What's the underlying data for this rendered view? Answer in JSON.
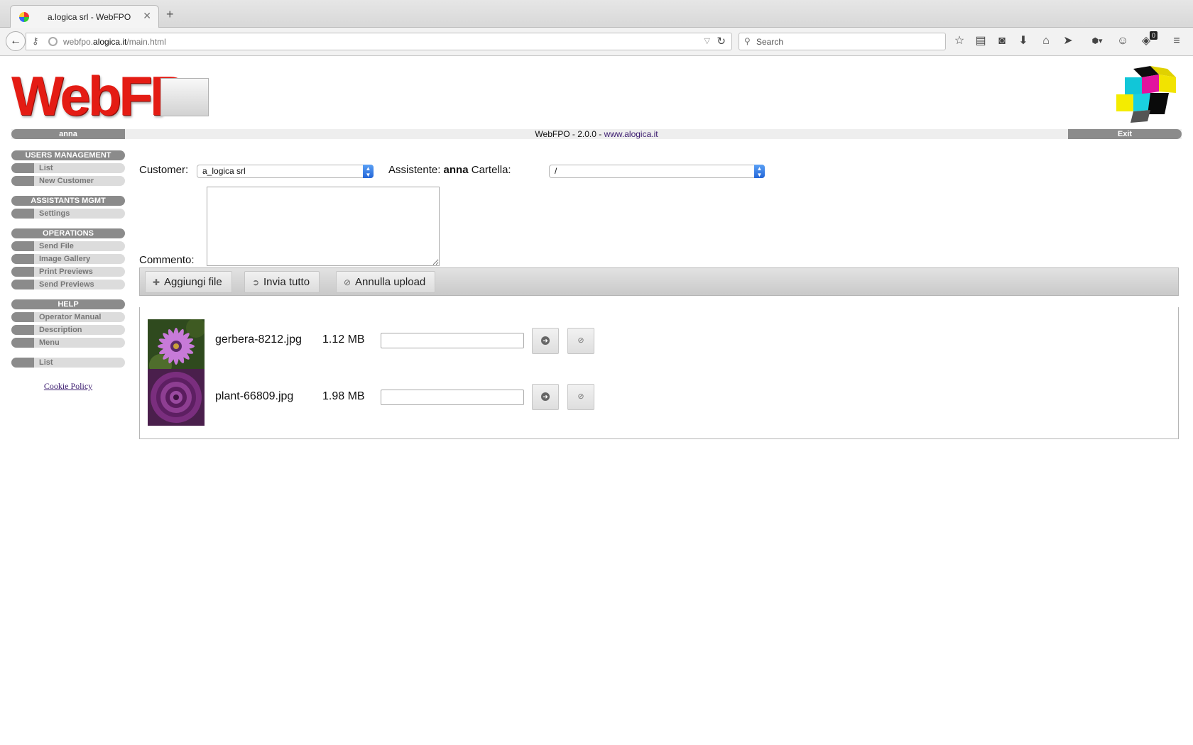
{
  "browser": {
    "tab_title": "a.logica srl - WebFPO",
    "url_host_prefix": "webfpo.",
    "url_domain": "alogica.it",
    "url_path": "/main.html",
    "search_placeholder": "Search",
    "notification_count": "0"
  },
  "header": {
    "logo_text": "WebFP",
    "user_name": "anna",
    "version_prefix": "WebFPO - 2.0.0 - ",
    "version_link": "www.alogica.it",
    "exit_label": "Exit"
  },
  "sidebar": {
    "sections": [
      {
        "title": "USERS MANAGEMENT",
        "items": [
          "List",
          "New Customer"
        ]
      },
      {
        "title": "ASSISTANTS MGMT",
        "items": [
          "Settings"
        ]
      },
      {
        "title": "OPERATIONS",
        "items": [
          "Send File",
          "Image Gallery",
          "Print Previews",
          "Send Previews"
        ]
      },
      {
        "title": "HELP",
        "items": [
          "Operator Manual",
          "Description",
          "Menu"
        ]
      }
    ],
    "extra_item": "List",
    "cookie_policy": "Cookie Policy"
  },
  "form": {
    "customer_label": "Customer:",
    "customer_value": "a_logica srl",
    "assistant_label": "Assistente:",
    "assistant_name": "anna",
    "folder_label": "Cartella:",
    "folder_value": "/",
    "comment_label": "Commento:",
    "comment_value": "",
    "add_files_label": "Aggiungi file",
    "send_all_label": "Invia tutto",
    "cancel_upload_label": "Annulla upload"
  },
  "files": [
    {
      "name": "gerbera-8212.jpg",
      "size": "1.12 MB",
      "progress": 0
    },
    {
      "name": "plant-66809.jpg",
      "size": "1.98 MB",
      "progress": 0
    }
  ],
  "icons": {
    "add": "plus-icon",
    "send": "arrow-right-circle-icon",
    "cancel": "cancel-icon"
  }
}
